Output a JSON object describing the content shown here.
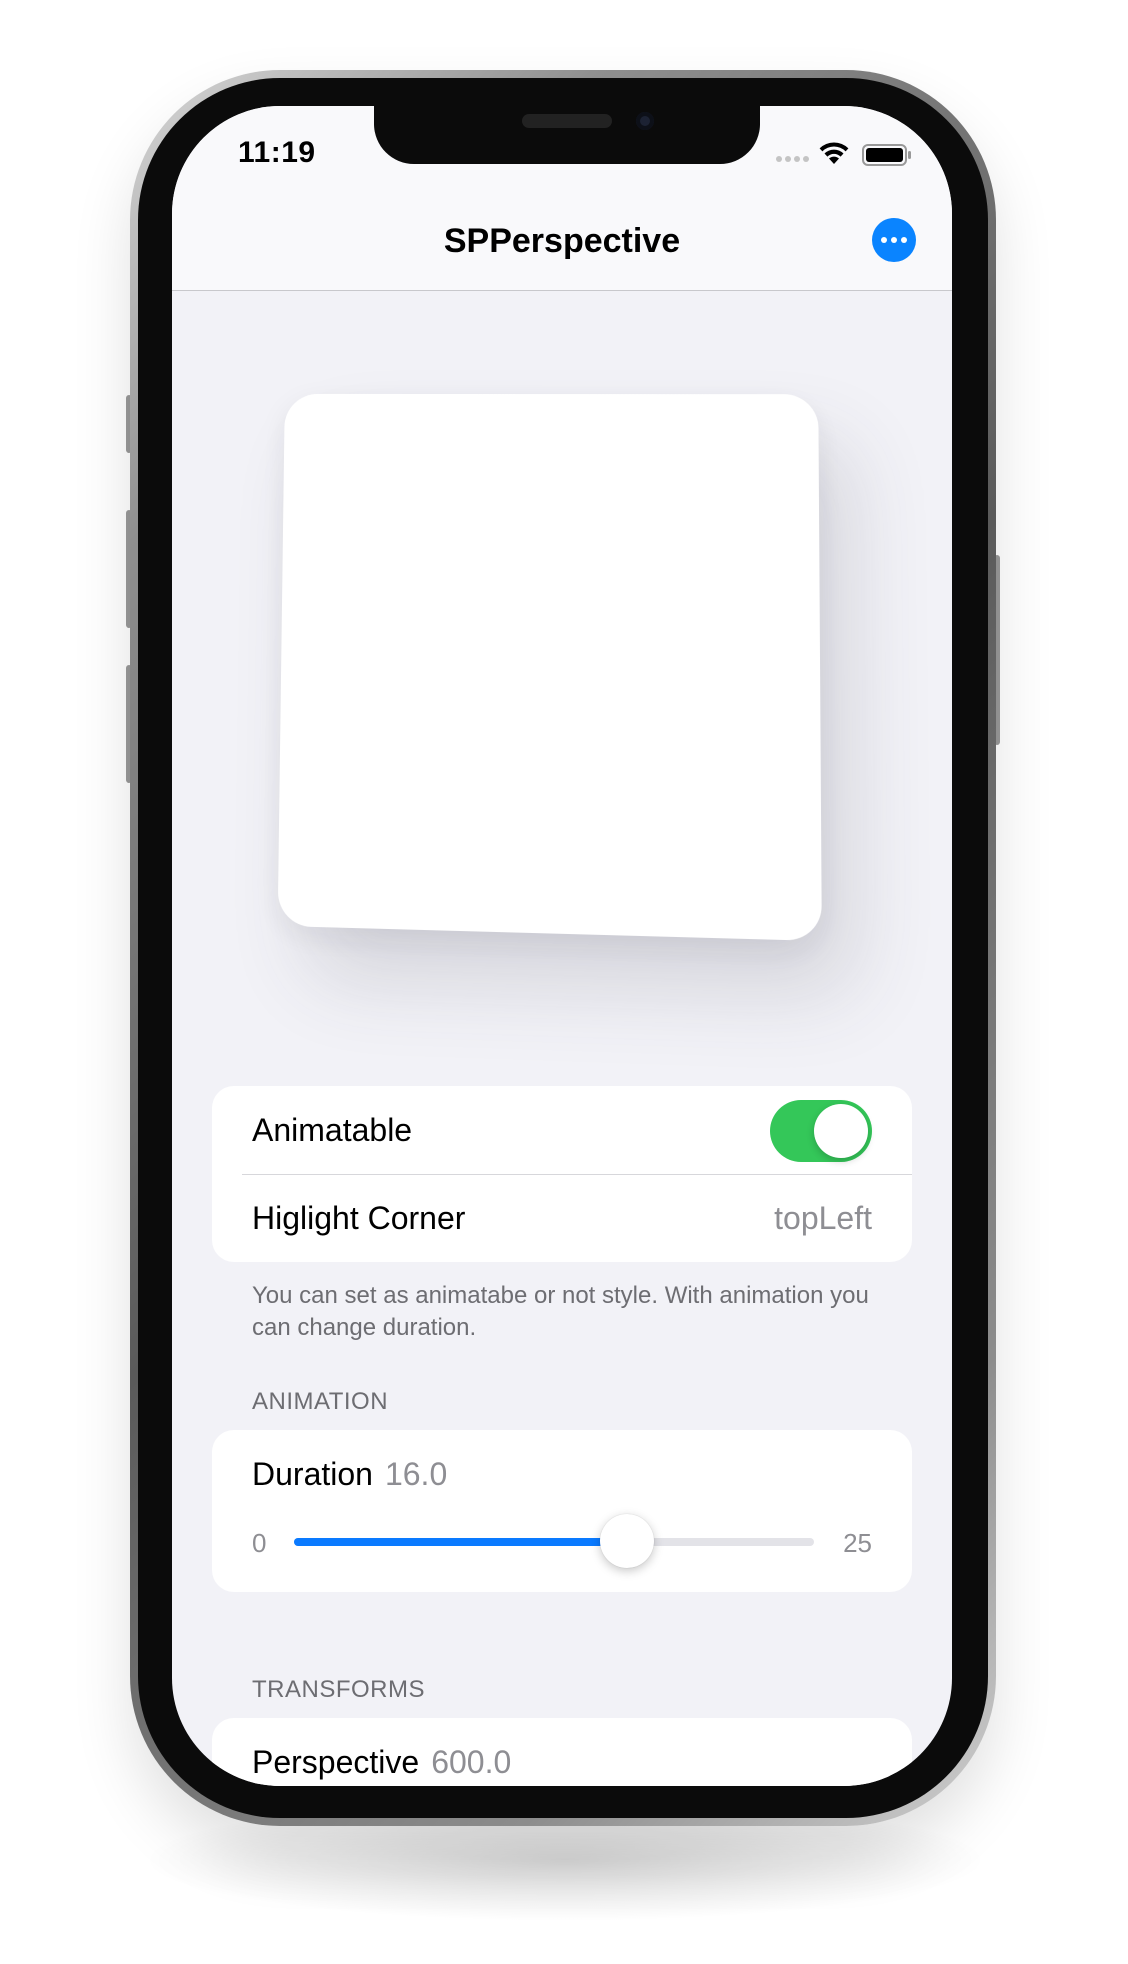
{
  "status_bar": {
    "time": "11:19"
  },
  "nav": {
    "title": "SPPerspective",
    "more_icon": "ellipsis-circle-icon"
  },
  "settings": {
    "animatable": {
      "label": "Animatable",
      "on": true
    },
    "highlight_corner": {
      "label": "Higlight Corner",
      "value": "topLeft"
    },
    "footer": "You can set as animatabe or not style. With animation you can change duration."
  },
  "animation": {
    "header": "ANIMATION",
    "duration": {
      "label": "Duration",
      "value": "16.0",
      "min": "0",
      "max": "25",
      "fraction": 0.64
    }
  },
  "transforms": {
    "header": "TRANSFORMS",
    "perspective": {
      "label": "Perspective",
      "value": "600.0"
    }
  },
  "colors": {
    "accent": "#0a84ff",
    "toggle_on": "#34c759",
    "background": "#f2f2f7"
  }
}
